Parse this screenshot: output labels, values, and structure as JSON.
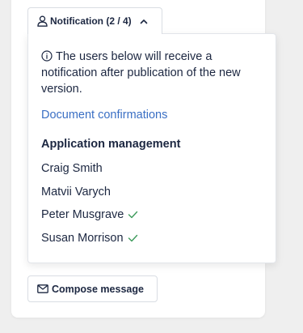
{
  "notification_tab": {
    "label": "Notification (2 / 4)",
    "icon": "user-icon",
    "toggle_icon": "chevron-up-icon"
  },
  "panel": {
    "info_icon": "info-icon",
    "info_text": "The users below will receive a notification after publication of the new version.",
    "document_link": "Document confirmations",
    "section_title": "Application management",
    "users": [
      {
        "name": "Craig Smith",
        "confirmed": false
      },
      {
        "name": "Matvii Varych",
        "confirmed": false
      },
      {
        "name": "Peter Musgrave",
        "confirmed": true
      },
      {
        "name": "Susan Morrison",
        "confirmed": true
      }
    ]
  },
  "compose_button": {
    "label": "Compose message",
    "icon": "envelope-icon"
  },
  "colors": {
    "link": "#3a6fc4",
    "check": "#3d9a5b",
    "text": "#1c2741"
  }
}
